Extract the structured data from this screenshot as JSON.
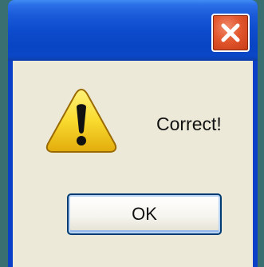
{
  "dialog": {
    "message": "Correct!",
    "ok_label": "OK",
    "icon": "warning-icon",
    "close_icon": "close-icon"
  },
  "colors": {
    "title_bar": "#0a47c6",
    "close_button": "#e2562d",
    "client_background": "#ece9d8",
    "warning_yellow": "#f7d22a",
    "ok_border": "#003c74"
  }
}
